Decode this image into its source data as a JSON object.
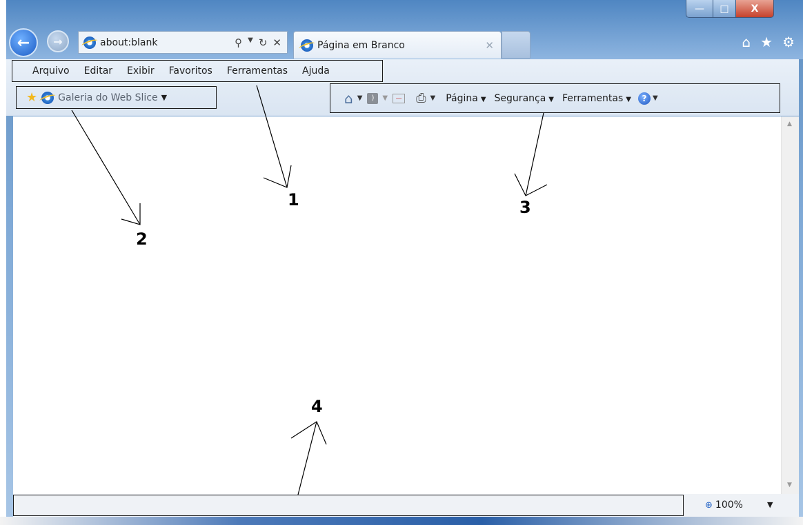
{
  "address": {
    "url": "about:blank"
  },
  "tab": {
    "title": "Página em Branco"
  },
  "menu": [
    "Arquivo",
    "Editar",
    "Exibir",
    "Favoritos",
    "Ferramentas",
    "Ajuda"
  ],
  "favorites_bar": {
    "gallery_label": "Galeria do Web Slice"
  },
  "command_bar": {
    "page": "Página",
    "security": "Segurança",
    "tools": "Ferramentas"
  },
  "status": {
    "zoom": "100%"
  },
  "annotations": [
    "1",
    "2",
    "3",
    "4"
  ],
  "icons": [
    "back-icon",
    "forward-icon",
    "ie-icon",
    "search-icon",
    "refresh-icon",
    "stop-icon",
    "home-icon",
    "star-icon",
    "gear-icon",
    "rss-icon",
    "mail-icon",
    "print-icon",
    "help-icon",
    "zoom-icon"
  ],
  "colors": {
    "titlebar": "#5f8fc1",
    "close_button": "#c6412b",
    "command_bg": "#e3ebf5"
  }
}
